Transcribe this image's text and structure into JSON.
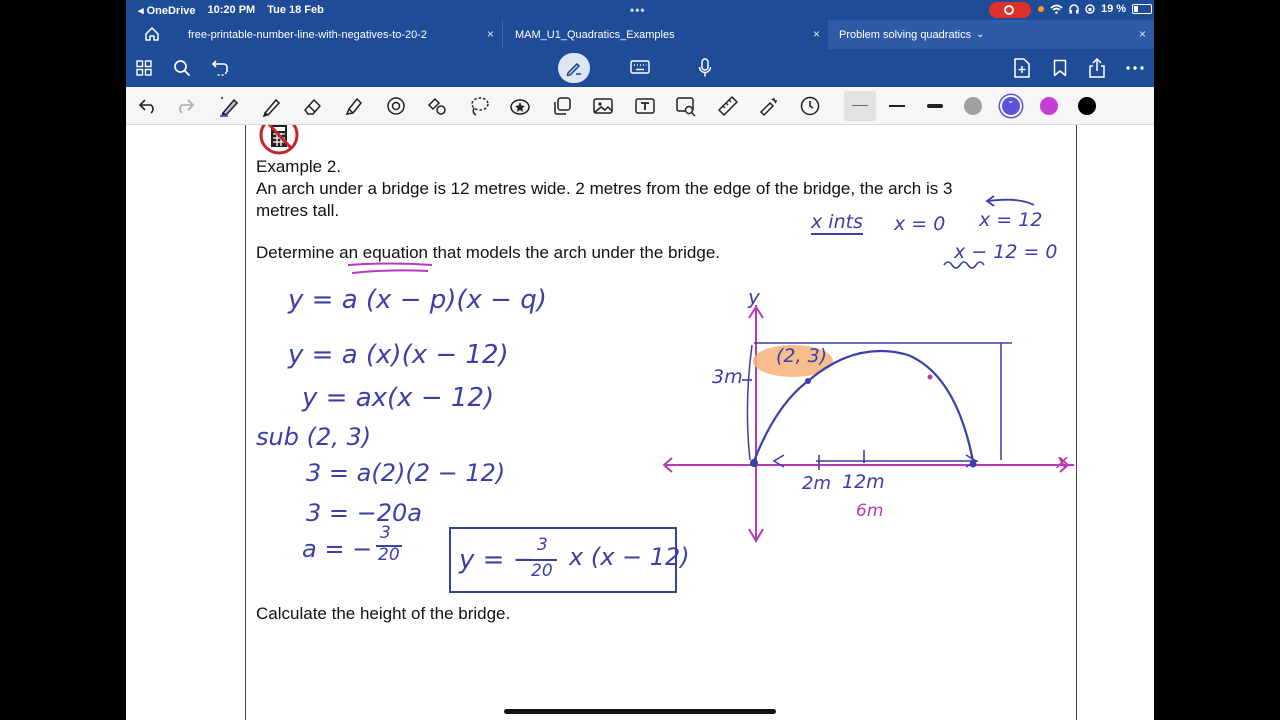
{
  "status_bar": {
    "back_app": "◂ OneDrive",
    "time": "10:20 PM",
    "date": "Tue 18 Feb",
    "multitask_dots": "•••",
    "battery_percent": "19 %"
  },
  "tabs": [
    {
      "label": "free-printable-number-line-with-negatives-to-20-2",
      "close": "×"
    },
    {
      "label": "MAM_U1_Quadratics_Examples",
      "close": "×"
    },
    {
      "label": "Problem solving quadratics",
      "chevron": "⌄",
      "close": "×"
    }
  ],
  "colors": {
    "chrome_blue": "#1f4c97",
    "ink_blue": "#3b3fa8",
    "ink_pink": "#b83ab8",
    "highlight_orange": "#f6b278",
    "record_red": "#e0302b"
  },
  "palette_swatches": [
    "#a0a0a0",
    "#5b55d6",
    "#c43fd3",
    "#000000"
  ],
  "document": {
    "example_heading": "Example 2.",
    "problem_line1": "An arch under a bridge is 12 metres wide. 2 metres from the edge of the bridge, the arch is 3",
    "problem_line2": "metres tall.",
    "task1": "Determine an equation that models the arch under the bridge.",
    "task2": "Calculate the height of the bridge."
  },
  "handwriting": {
    "step1": "y = a (x − p)(x − q)",
    "step2": "y = a (x)(x − 12)",
    "step3": "y = ax(x − 12)",
    "sub": "sub (2, 3)",
    "step4": "3 = a(2)(2 − 12)",
    "step5": "3 = −20a",
    "step6_prefix": "a = −",
    "step6_num": "3",
    "step6_den": "20",
    "answer_prefix": "y = −",
    "answer_num": "3",
    "answer_den": "20",
    "answer_suffix": "x (x − 12)",
    "note_x_ints": "x ints",
    "note_x0": "x = 0",
    "note_x12": "x = 12",
    "note_x12b": "x − 12 = 0",
    "graph_y": "y",
    "graph_x": "x",
    "graph_point": "(2, 3)",
    "graph_3m": "3m",
    "graph_2m": "2m",
    "graph_12m": "12m",
    "graph_6m": "6m"
  }
}
